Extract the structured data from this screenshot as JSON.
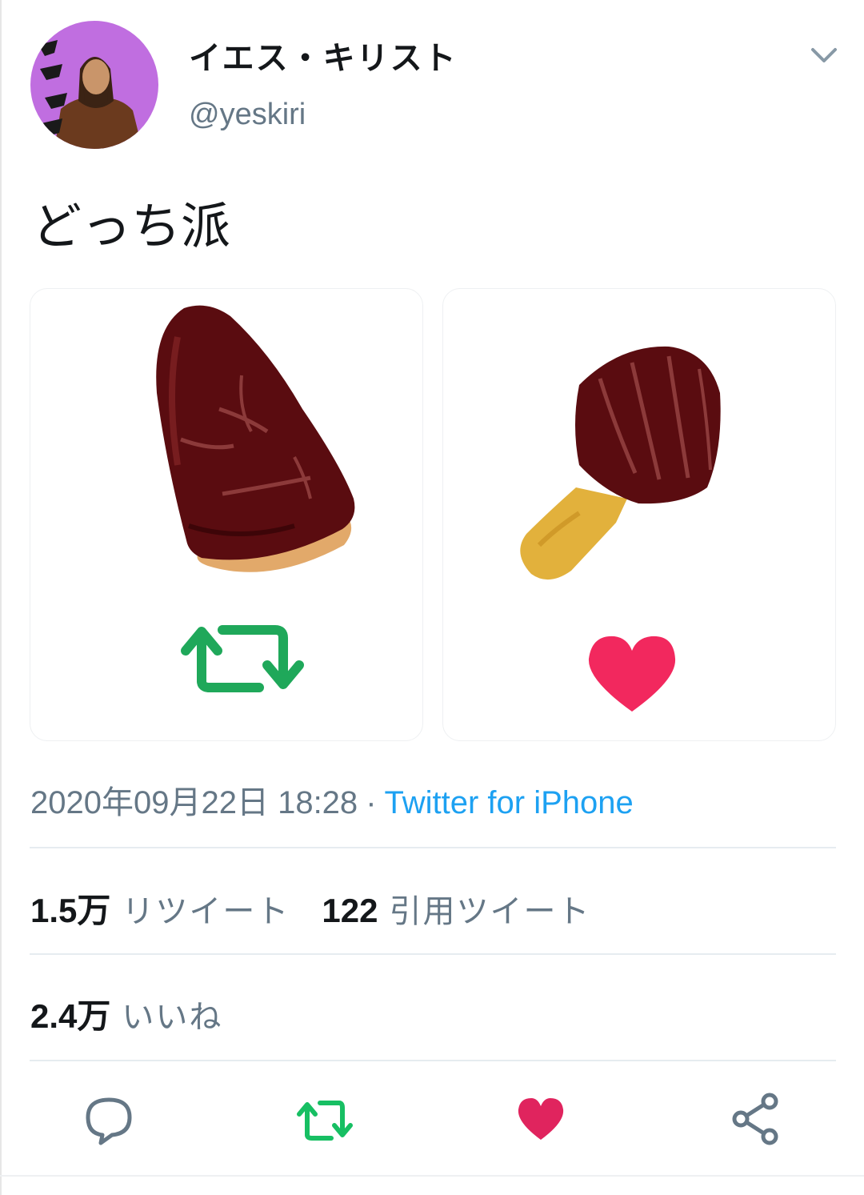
{
  "user": {
    "display_name": "イエス・キリスト",
    "handle": "@yeskiri"
  },
  "tweet": {
    "text": "どっち派",
    "timestamp": "2020年09月22日 18:28",
    "separator": "·",
    "source": "Twitter for iPhone"
  },
  "media": {
    "left": {
      "icon": "retweet-icon",
      "food": "takenoko-chocolate"
    },
    "right": {
      "icon": "heart-icon",
      "food": "kinoko-chocolate"
    }
  },
  "stats": {
    "retweets_count": "1.5万",
    "retweets_label": "リツイート",
    "quotes_count": "122",
    "quotes_label": "引用ツイート",
    "likes_count": "2.4万",
    "likes_label": "いいね"
  },
  "actions": [
    "reply-icon",
    "retweet-icon",
    "like-icon",
    "share-icon"
  ],
  "colors": {
    "retweet_green": "#17bf63",
    "like_red": "#e0245e",
    "link_blue": "#1da1f2",
    "secondary_text": "#657786",
    "avatar_bg": "#b565d8"
  }
}
